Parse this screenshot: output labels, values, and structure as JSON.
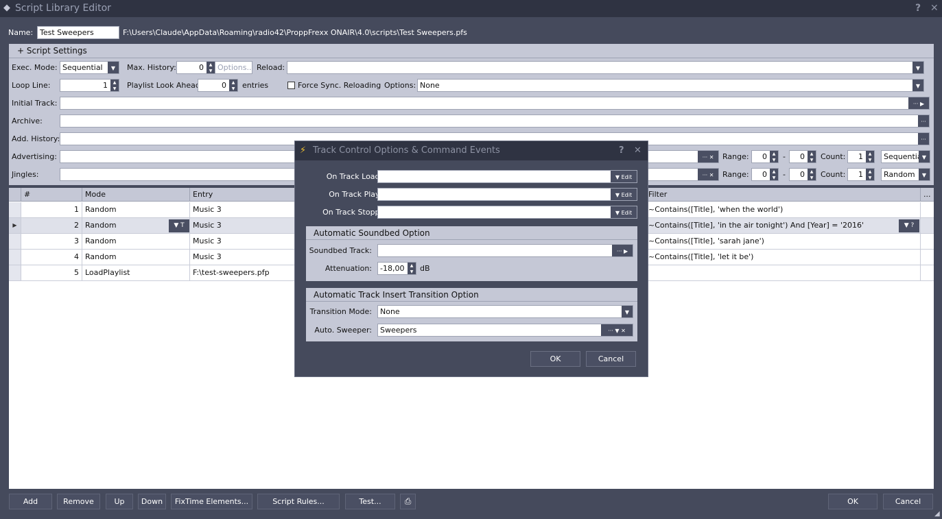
{
  "window": {
    "title": "Script Library Editor",
    "help": "?",
    "close": "✕"
  },
  "name_row": {
    "label": "Name:",
    "value": "Test Sweepers",
    "path": "F:\\Users\\Claude\\AppData\\Roaming\\radio42\\ProppFrexx ONAIR\\4.0\\scripts\\Test Sweepers.pfs"
  },
  "settings": {
    "header": "+ Script Settings",
    "exec_mode_label": "Exec. Mode:",
    "exec_mode": "Sequential",
    "max_history_label": "Max. History:",
    "max_history": "0",
    "options_btn": "Options...",
    "reload_label": "Reload:",
    "reload": "",
    "loop_line_label": "Loop Line:",
    "loop_line": "1",
    "lookahead_label": "Playlist Look Ahead:",
    "lookahead": "0",
    "entries_label": "entries",
    "force_sync_label": "Force Sync. Reloading",
    "options_label": "Options:",
    "options": "None",
    "initial_track_label": "Initial Track:",
    "archive_label": "Archive:",
    "add_history_label": "Add. History:",
    "advertising_label": "Advertising:",
    "jingles_label": "Jingles:",
    "range_label": "Range:",
    "dash": "-",
    "count_label": "Count:",
    "adv_range_from": "0",
    "adv_range_to": "0",
    "adv_count": "1",
    "adv_mode": "Sequential",
    "jin_range_from": "0",
    "jin_range_to": "0",
    "jin_count": "1",
    "jin_mode": "Random"
  },
  "grid": {
    "headers": [
      "#",
      "Mode",
      "Entry",
      "Filter",
      "..."
    ],
    "rows": [
      {
        "n": "1",
        "mode": "Random",
        "entry": "Music 3",
        "filter": "~Contains([Title], 'when the world')"
      },
      {
        "n": "2",
        "mode": "Random",
        "entry": "Music 3",
        "filter": "~Contains([Title], 'in the air tonight') And [Year] = '2016'"
      },
      {
        "n": "3",
        "mode": "Random",
        "entry": "Music 3",
        "filter": "~Contains([Title], 'sarah jane')"
      },
      {
        "n": "4",
        "mode": "Random",
        "entry": "Music 3",
        "filter": "~Contains([Title], 'let it be')"
      },
      {
        "n": "5",
        "mode": "LoadPlaylist",
        "entry": "F:\\test-sweepers.pfp",
        "filter": ""
      }
    ],
    "row2_btn_t": "T",
    "row2_btn_q": "?"
  },
  "bottom": {
    "add": "Add",
    "remove": "Remove",
    "up": "Up",
    "down": "Down",
    "fixtime": "FixTime Elements...",
    "rules": "Script Rules...",
    "test": "Test...",
    "ok": "OK",
    "cancel": "Cancel"
  },
  "dialog": {
    "title": "Track Control Options & Command Events",
    "help": "?",
    "close": "✕",
    "on_loaded_label": "On Track Loaded:",
    "on_played_label": "On Track Played:",
    "on_stopped_label": "On Track Stopped:",
    "edit": "Edit",
    "soundbed_group": "Automatic Soundbed Option",
    "soundbed_track_label": "Soundbed Track:",
    "attenuation_label": "Attenuation:",
    "attenuation": "-18,00",
    "db": "dB",
    "transition_group": "Automatic Track Insert Transition Option",
    "transition_mode_label": "Transition Mode:",
    "transition_mode": "None",
    "sweeper_label": "Auto. Sweeper:",
    "sweeper": "Sweepers",
    "ok": "OK",
    "cancel": "Cancel"
  }
}
